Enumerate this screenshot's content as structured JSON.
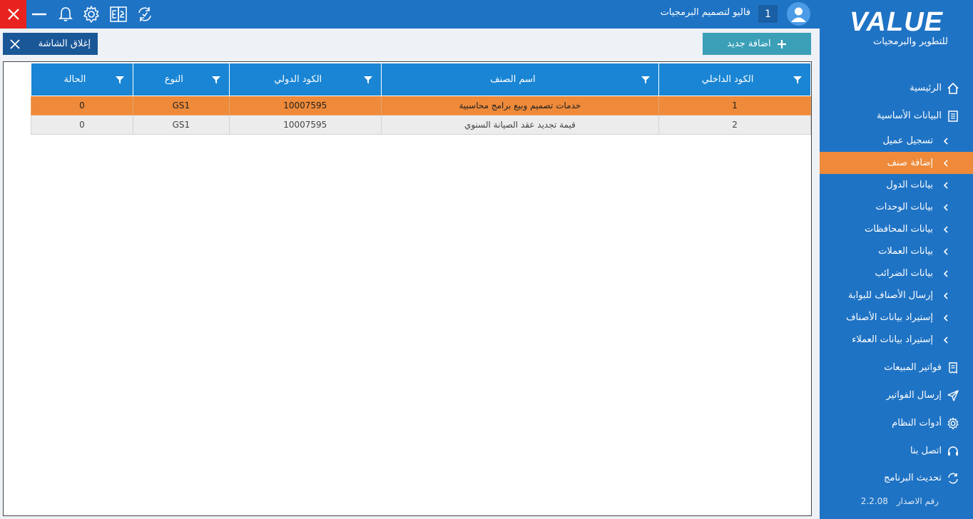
{
  "topbar": {
    "company_name": "فاليو لتصميم البرمجيات",
    "counter": "1",
    "icons": [
      "close-icon",
      "minimize-icon",
      "bell-icon",
      "gear-icon",
      "language-icon",
      "refresh-icon",
      "user-icon"
    ]
  },
  "toolbar": {
    "close_screen_label": "إغلاق الشاشة",
    "add_new_label": "اضافة جديد"
  },
  "table": {
    "columns": [
      "الكود الداخلي",
      "اسم الصنف",
      "الكود الدولي",
      "النوع",
      "الحالة"
    ],
    "rows": [
      [
        "1",
        "خدمات تصميم وبيع برامج محاسبية",
        "10007595",
        "GS1",
        "0"
      ],
      [
        "2",
        "قيمة تجديد عقد الصيانة السنوي",
        "10007595",
        "GS1",
        "0"
      ]
    ],
    "selected_row": 0
  },
  "sidebar": {
    "logo_main": "VALUE",
    "logo_sub": "للتطوير والبرمجيات",
    "items": [
      {
        "label": "الرئيسية",
        "icon": "home-icon"
      },
      {
        "label": "البيانات الأساسية",
        "icon": "document-icon"
      },
      {
        "label": "تسجيل عميل"
      },
      {
        "label": "إضافة صنف"
      },
      {
        "label": "بيانات الدول"
      },
      {
        "label": "بيانات الوحدات"
      },
      {
        "label": "بيانات المحافظات"
      },
      {
        "label": "بيانات العملات"
      },
      {
        "label": "بيانات الضرائب"
      },
      {
        "label": "إرسال الأصناف للبوابة"
      },
      {
        "label": "إستيراد بيانات الأصناف"
      },
      {
        "label": "إستيراد بيانات العملاء"
      },
      {
        "label": "فواتير المبيعات",
        "icon": "receipt-icon"
      },
      {
        "label": "إرسال الفواتير",
        "icon": "send-icon"
      },
      {
        "label": "أدوات النظام",
        "icon": "gear-icon"
      },
      {
        "label": "اتصل بنا",
        "icon": "headset-icon"
      },
      {
        "label": "تحديث البرنامج",
        "icon": "refresh-icon"
      }
    ],
    "active_item": "إضافة صنف",
    "version_label": "رقم الاصدار",
    "version_value": "2.2.08"
  },
  "colors": {
    "primary": "#1f73c4",
    "header": "#1a85d4",
    "accent": "#ee8a3a",
    "close_red": "#e8231f",
    "add_button": "#3a9fb7"
  }
}
